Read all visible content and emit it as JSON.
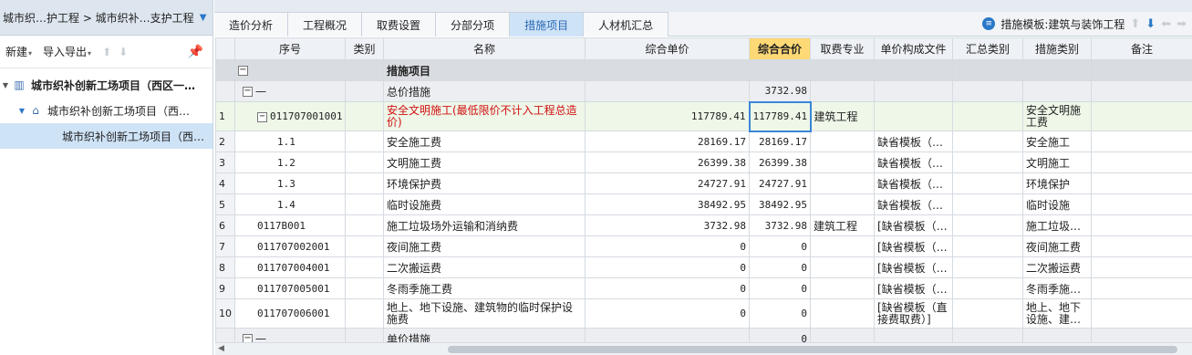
{
  "left_panel": {
    "breadcrumb": "城市织…护工程 > 城市织补…支护工程",
    "toolbar": {
      "new_label": "新建",
      "import_export_label": "导入导出"
    },
    "tree": [
      {
        "label": "城市织补创新工场项目（西区一…"
      },
      {
        "label": "城市织补创新工场项目（西…"
      },
      {
        "label": "城市织补创新工场项目（西…"
      }
    ]
  },
  "tabs": [
    "造价分析",
    "工程概况",
    "取费设置",
    "分部分项",
    "措施项目",
    "人材机汇总"
  ],
  "active_tab": "措施项目",
  "template_label": "措施模板:建筑与装饰工程",
  "columns": [
    "序号",
    "类别",
    "名称",
    "综合单价",
    "综合合价",
    "取费专业",
    "单价构成文件",
    "汇总类别",
    "措施类别",
    "备注"
  ],
  "rows": [
    {
      "rn": "",
      "code": "",
      "name": "措施项目",
      "price": "",
      "total": "",
      "major": "",
      "file": "",
      "sum": "",
      "cat": "",
      "note": ""
    },
    {
      "rn": "",
      "code": "—",
      "name": "总价措施",
      "price": "",
      "total": "3732.98",
      "major": "",
      "file": "",
      "sum": "",
      "cat": "",
      "note": ""
    },
    {
      "rn": "1",
      "code": "011707001001",
      "name": "安全文明施工(最低限价不计入工程总造价)",
      "price": "117789.41",
      "total": "117789.41",
      "major": "建筑工程",
      "file": "",
      "sum": "",
      "cat": "安全文明施工费",
      "note": ""
    },
    {
      "rn": "2",
      "code": "1.1",
      "name": "安全施工费",
      "price": "28169.17",
      "total": "28169.17",
      "major": "",
      "file": "缺省模板（…",
      "sum": "",
      "cat": "安全施工",
      "note": ""
    },
    {
      "rn": "3",
      "code": "1.2",
      "name": "文明施工费",
      "price": "26399.38",
      "total": "26399.38",
      "major": "",
      "file": "缺省模板（…",
      "sum": "",
      "cat": "文明施工",
      "note": ""
    },
    {
      "rn": "4",
      "code": "1.3",
      "name": "环境保护费",
      "price": "24727.91",
      "total": "24727.91",
      "major": "",
      "file": "缺省模板（…",
      "sum": "",
      "cat": "环境保护",
      "note": ""
    },
    {
      "rn": "5",
      "code": "1.4",
      "name": "临时设施费",
      "price": "38492.95",
      "total": "38492.95",
      "major": "",
      "file": "缺省模板（…",
      "sum": "",
      "cat": "临时设施",
      "note": ""
    },
    {
      "rn": "6",
      "code": "0117B001",
      "name": "施工垃圾场外运输和消纳费",
      "price": "3732.98",
      "total": "3732.98",
      "major": "建筑工程",
      "file": "[缺省模板（…",
      "sum": "",
      "cat": "施工垃圾…",
      "note": ""
    },
    {
      "rn": "7",
      "code": "011707002001",
      "name": "夜间施工费",
      "price": "0",
      "total": "0",
      "major": "",
      "file": "[缺省模板（…",
      "sum": "",
      "cat": "夜间施工费",
      "note": ""
    },
    {
      "rn": "8",
      "code": "011707004001",
      "name": "二次搬运费",
      "price": "0",
      "total": "0",
      "major": "",
      "file": "[缺省模板（…",
      "sum": "",
      "cat": "二次搬运费",
      "note": ""
    },
    {
      "rn": "9",
      "code": "011707005001",
      "name": "冬雨季施工费",
      "price": "0",
      "total": "0",
      "major": "",
      "file": "[缺省模板（…",
      "sum": "",
      "cat": "冬雨季施…",
      "note": ""
    },
    {
      "rn": "10",
      "code": "011707006001",
      "name": "地上、地下设施、建筑物的临时保护设施费",
      "price": "0",
      "total": "0",
      "major": "",
      "file": "[缺省模板（直接费取费）]",
      "sum": "",
      "cat": "地上、地下设施、建…",
      "note": ""
    },
    {
      "rn": "",
      "code": "—",
      "name": "单价措施",
      "price": "",
      "total": "0",
      "major": "",
      "file": "",
      "sum": "",
      "cat": "",
      "note": ""
    }
  ]
}
